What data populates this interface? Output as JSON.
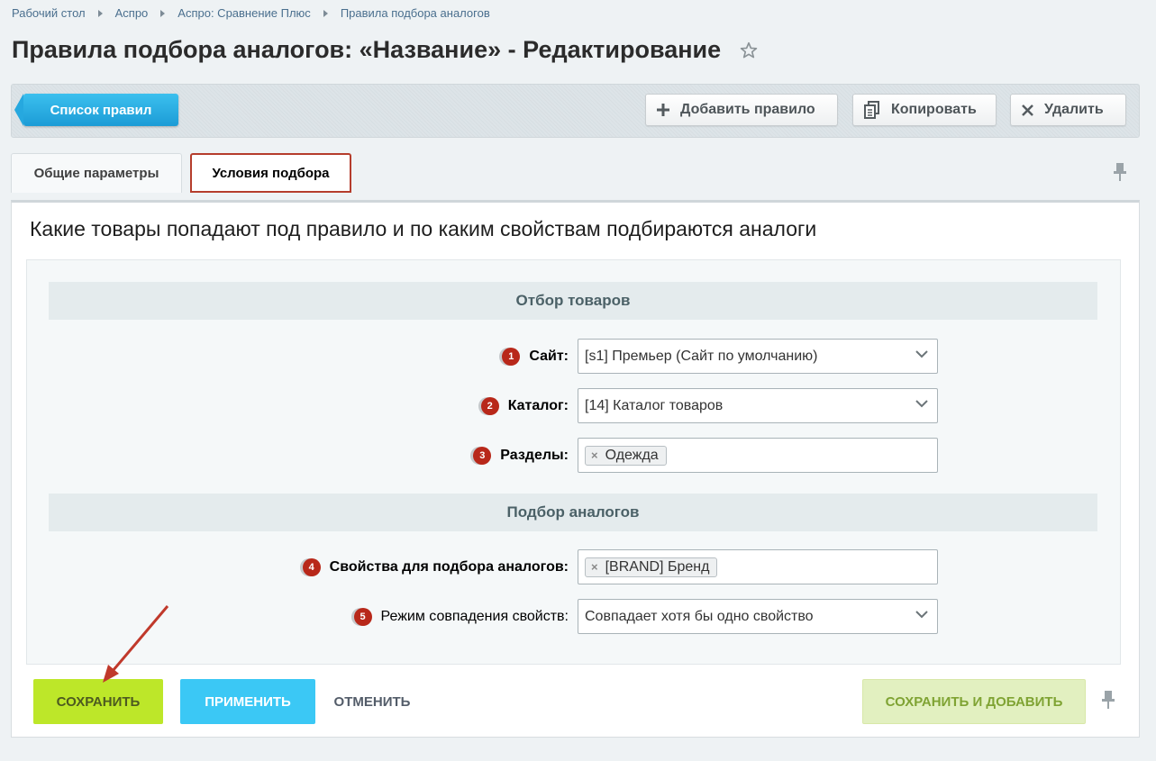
{
  "breadcrumbs": [
    "Рабочий стол",
    "Аспро",
    "Аспро: Сравнение Плюс",
    "Правила подбора аналогов"
  ],
  "page_title": "Правила подбора аналогов: «Название» - Редактирование",
  "toolbar": {
    "list_label": "Список правил",
    "add_label": "Добавить правило",
    "copy_label": "Копировать",
    "delete_label": "Удалить"
  },
  "tabs": [
    {
      "label": "Общие параметры",
      "active": false
    },
    {
      "label": "Условия подбора",
      "active": true
    }
  ],
  "panel_heading": "Какие товары попадают под правило и по каким свойствам подбираются аналоги",
  "sections": {
    "filter_title": "Отбор товаров",
    "analogs_title": "Подбор аналогов"
  },
  "fields": {
    "site": {
      "badge": "1",
      "label": "Сайт:",
      "value": "[s1] Премьер (Сайт по умолчанию)"
    },
    "catalog": {
      "badge": "2",
      "label": "Каталог:",
      "value": "[14] Каталог товаров"
    },
    "sections": {
      "badge": "3",
      "label": "Разделы:",
      "tag": "Одежда"
    },
    "properties": {
      "badge": "4",
      "label": "Свойства для подбора аналогов:",
      "tag": "[BRAND] Бренд"
    },
    "match_mode": {
      "badge": "5",
      "label": "Режим совпадения свойств:",
      "value": "Совпадает хотя бы одно свойство"
    }
  },
  "footer": {
    "save_label": "СОХРАНИТЬ",
    "apply_label": "ПРИМЕНИТЬ",
    "cancel_label": "ОТМЕНИТЬ",
    "save_add_label": "СОХРАНИТЬ И ДОБАВИТЬ"
  },
  "colors": {
    "accent_blue": "#3bc8f5",
    "save_green": "#bde729",
    "highlight_red": "#b53d2c",
    "badge_red": "#b8281a"
  }
}
